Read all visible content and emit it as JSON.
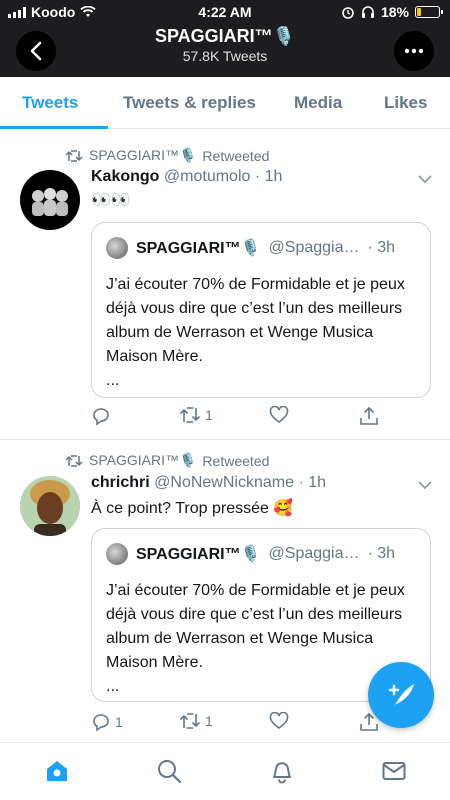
{
  "status_bar": {
    "carrier": "Koodo",
    "time": "4:22 AM",
    "battery": "18%",
    "battery_level": 0.18
  },
  "header": {
    "title": "SPAGGIARI™🎙️",
    "subtitle": "57.8K Tweets"
  },
  "tabs": [
    {
      "label": "Tweets",
      "active": true
    },
    {
      "label": "Tweets & replies",
      "active": false
    },
    {
      "label": "Media",
      "active": false
    },
    {
      "label": "Likes",
      "active": false
    }
  ],
  "tweets": [
    {
      "retweeted_by": "SPAGGIARI™🎙️",
      "retweeted_label": "Retweeted",
      "name": "Kakongo",
      "handle": "@motumolo",
      "time": "· 1h",
      "text": "👀👀",
      "quote": {
        "name": "SPAGGIARI™🎙️",
        "handle": "@Spaggia…",
        "time": "· 3h",
        "text": "J’ai écouter 70% de Formidable et je peux déjà vous dire que c’est l’un des meilleurs album de Werrason et Wenge Musica Maison Mère.",
        "ellipsis": "..."
      },
      "reply_count": "",
      "retweet_count": "1",
      "like_count": ""
    },
    {
      "retweeted_by": "SPAGGIARI™🎙️",
      "retweeted_label": "Retweeted",
      "name": "chrichri",
      "handle": "@NoNewNickname",
      "time": "· 1h",
      "text": "À ce point? Trop pressée 🥰",
      "quote": {
        "name": "SPAGGIARI™🎙️",
        "handle": "@Spaggia…",
        "time": "· 3h",
        "text": "J’ai écouter 70% de Formidable et je peux déjà vous dire que c’est l’un des meilleurs album de Werrason et Wenge Musica Maison Mère.",
        "ellipsis": "..."
      },
      "reply_count": "1",
      "retweet_count": "1",
      "like_count": ""
    }
  ],
  "icons": {
    "accent": "#1da1f2",
    "nav": [
      "home-icon",
      "search-icon",
      "notifications-icon",
      "messages-icon"
    ],
    "fab": "compose-tweet-icon"
  }
}
